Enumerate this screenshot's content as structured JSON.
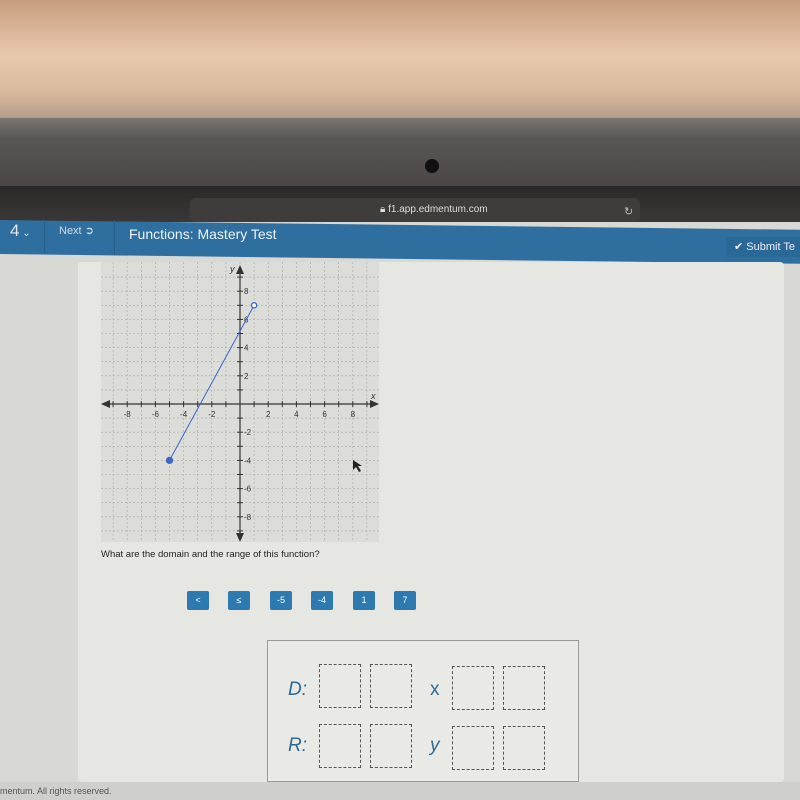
{
  "browser": {
    "url": "f1.app.edmentum.com",
    "lock_icon": "lock-icon",
    "reload_icon": "reload-icon"
  },
  "nav": {
    "question_number": "4",
    "next_label": "Next",
    "title": "Functions: Mastery Test",
    "submit_label": "Submit Te"
  },
  "graph": {
    "x_label": "x",
    "y_label": "y",
    "x_ticks": [
      "-8",
      "-6",
      "-4",
      "-2",
      "2",
      "4",
      "6",
      "8"
    ],
    "y_ticks": [
      "8",
      "6",
      "4",
      "2",
      "-2",
      "-4",
      "-6",
      "-8"
    ],
    "range": [
      -9.5,
      9.5
    ],
    "segment": {
      "start": [
        -5,
        -4
      ],
      "start_closed": true,
      "end": [
        1,
        7
      ],
      "end_closed": false,
      "color": "#3a66c9"
    }
  },
  "question": "What are the domain and the range of this function?",
  "tiles": [
    "<",
    "≤",
    "-5",
    "-4",
    "1",
    "7"
  ],
  "answer": {
    "domain_label": "D:",
    "range_label": "R:",
    "x_var": "x",
    "y_var": "y"
  },
  "footer": "mentum. All rights reserved.",
  "colors": {
    "nav": "#2f6f9f",
    "tile": "#2d7ab0",
    "label": "#2d6a95"
  }
}
